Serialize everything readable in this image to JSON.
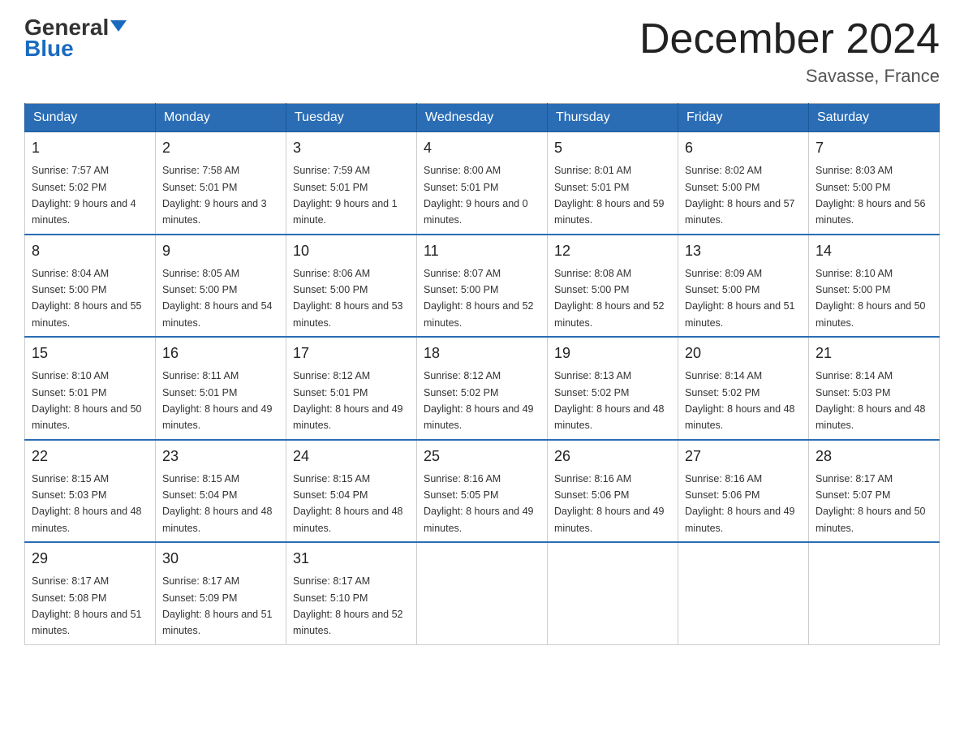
{
  "header": {
    "logo_general": "General",
    "logo_blue": "Blue",
    "month_title": "December 2024",
    "location": "Savasse, France"
  },
  "days_of_week": [
    "Sunday",
    "Monday",
    "Tuesday",
    "Wednesday",
    "Thursday",
    "Friday",
    "Saturday"
  ],
  "weeks": [
    [
      {
        "day": "1",
        "sunrise": "7:57 AM",
        "sunset": "5:02 PM",
        "daylight": "9 hours and 4 minutes."
      },
      {
        "day": "2",
        "sunrise": "7:58 AM",
        "sunset": "5:01 PM",
        "daylight": "9 hours and 3 minutes."
      },
      {
        "day": "3",
        "sunrise": "7:59 AM",
        "sunset": "5:01 PM",
        "daylight": "9 hours and 1 minute."
      },
      {
        "day": "4",
        "sunrise": "8:00 AM",
        "sunset": "5:01 PM",
        "daylight": "9 hours and 0 minutes."
      },
      {
        "day": "5",
        "sunrise": "8:01 AM",
        "sunset": "5:01 PM",
        "daylight": "8 hours and 59 minutes."
      },
      {
        "day": "6",
        "sunrise": "8:02 AM",
        "sunset": "5:00 PM",
        "daylight": "8 hours and 57 minutes."
      },
      {
        "day": "7",
        "sunrise": "8:03 AM",
        "sunset": "5:00 PM",
        "daylight": "8 hours and 56 minutes."
      }
    ],
    [
      {
        "day": "8",
        "sunrise": "8:04 AM",
        "sunset": "5:00 PM",
        "daylight": "8 hours and 55 minutes."
      },
      {
        "day": "9",
        "sunrise": "8:05 AM",
        "sunset": "5:00 PM",
        "daylight": "8 hours and 54 minutes."
      },
      {
        "day": "10",
        "sunrise": "8:06 AM",
        "sunset": "5:00 PM",
        "daylight": "8 hours and 53 minutes."
      },
      {
        "day": "11",
        "sunrise": "8:07 AM",
        "sunset": "5:00 PM",
        "daylight": "8 hours and 52 minutes."
      },
      {
        "day": "12",
        "sunrise": "8:08 AM",
        "sunset": "5:00 PM",
        "daylight": "8 hours and 52 minutes."
      },
      {
        "day": "13",
        "sunrise": "8:09 AM",
        "sunset": "5:00 PM",
        "daylight": "8 hours and 51 minutes."
      },
      {
        "day": "14",
        "sunrise": "8:10 AM",
        "sunset": "5:00 PM",
        "daylight": "8 hours and 50 minutes."
      }
    ],
    [
      {
        "day": "15",
        "sunrise": "8:10 AM",
        "sunset": "5:01 PM",
        "daylight": "8 hours and 50 minutes."
      },
      {
        "day": "16",
        "sunrise": "8:11 AM",
        "sunset": "5:01 PM",
        "daylight": "8 hours and 49 minutes."
      },
      {
        "day": "17",
        "sunrise": "8:12 AM",
        "sunset": "5:01 PM",
        "daylight": "8 hours and 49 minutes."
      },
      {
        "day": "18",
        "sunrise": "8:12 AM",
        "sunset": "5:02 PM",
        "daylight": "8 hours and 49 minutes."
      },
      {
        "day": "19",
        "sunrise": "8:13 AM",
        "sunset": "5:02 PM",
        "daylight": "8 hours and 48 minutes."
      },
      {
        "day": "20",
        "sunrise": "8:14 AM",
        "sunset": "5:02 PM",
        "daylight": "8 hours and 48 minutes."
      },
      {
        "day": "21",
        "sunrise": "8:14 AM",
        "sunset": "5:03 PM",
        "daylight": "8 hours and 48 minutes."
      }
    ],
    [
      {
        "day": "22",
        "sunrise": "8:15 AM",
        "sunset": "5:03 PM",
        "daylight": "8 hours and 48 minutes."
      },
      {
        "day": "23",
        "sunrise": "8:15 AM",
        "sunset": "5:04 PM",
        "daylight": "8 hours and 48 minutes."
      },
      {
        "day": "24",
        "sunrise": "8:15 AM",
        "sunset": "5:04 PM",
        "daylight": "8 hours and 48 minutes."
      },
      {
        "day": "25",
        "sunrise": "8:16 AM",
        "sunset": "5:05 PM",
        "daylight": "8 hours and 49 minutes."
      },
      {
        "day": "26",
        "sunrise": "8:16 AM",
        "sunset": "5:06 PM",
        "daylight": "8 hours and 49 minutes."
      },
      {
        "day": "27",
        "sunrise": "8:16 AM",
        "sunset": "5:06 PM",
        "daylight": "8 hours and 49 minutes."
      },
      {
        "day": "28",
        "sunrise": "8:17 AM",
        "sunset": "5:07 PM",
        "daylight": "8 hours and 50 minutes."
      }
    ],
    [
      {
        "day": "29",
        "sunrise": "8:17 AM",
        "sunset": "5:08 PM",
        "daylight": "8 hours and 51 minutes."
      },
      {
        "day": "30",
        "sunrise": "8:17 AM",
        "sunset": "5:09 PM",
        "daylight": "8 hours and 51 minutes."
      },
      {
        "day": "31",
        "sunrise": "8:17 AM",
        "sunset": "5:10 PM",
        "daylight": "8 hours and 52 minutes."
      },
      null,
      null,
      null,
      null
    ]
  ],
  "labels": {
    "sunrise": "Sunrise:",
    "sunset": "Sunset:",
    "daylight": "Daylight:"
  }
}
